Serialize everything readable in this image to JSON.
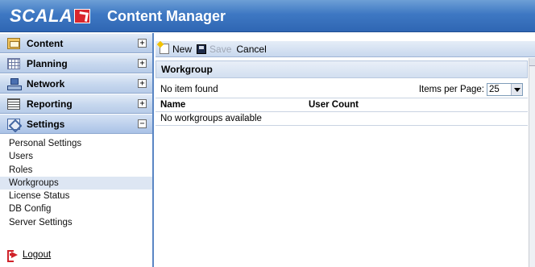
{
  "header": {
    "brand": "SCALA",
    "app_title": "Content Manager"
  },
  "sidebar": {
    "sections": [
      {
        "label": "Content",
        "icon": "folder-icon",
        "toggle": "+"
      },
      {
        "label": "Planning",
        "icon": "calendar-icon",
        "toggle": "+"
      },
      {
        "label": "Network",
        "icon": "network-icon",
        "toggle": "+"
      },
      {
        "label": "Reporting",
        "icon": "report-icon",
        "toggle": "+"
      },
      {
        "label": "Settings",
        "icon": "settings-icon",
        "toggle": "−"
      }
    ],
    "settings_items": [
      {
        "label": "Personal Settings"
      },
      {
        "label": "Users"
      },
      {
        "label": "Roles"
      },
      {
        "label": "Workgroups",
        "selected": true
      },
      {
        "label": "License Status"
      },
      {
        "label": "DB Config"
      },
      {
        "label": "Server Settings"
      }
    ],
    "logout_label": "Logout"
  },
  "toolbar": {
    "new_label": "New",
    "save_label": "Save",
    "cancel_label": "Cancel"
  },
  "panel": {
    "title": "Workgroup",
    "status_text": "No item found",
    "items_per_page_label": "Items per Page:",
    "items_per_page_value": "25",
    "columns": [
      "Name",
      "User Count"
    ],
    "empty_message": "No workgroups available"
  },
  "colors": {
    "header_blue": "#3e78c3",
    "selected_item_bg": "#dde6f3",
    "logout_red": "#d0222a"
  }
}
